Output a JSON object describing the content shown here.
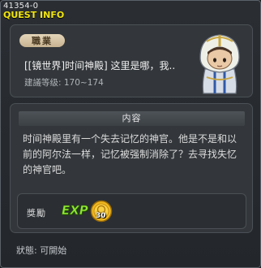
{
  "window": {
    "id_label": "41354-0",
    "title": "QUEST INFO"
  },
  "quest": {
    "job_badge": "職業",
    "name": "[[镜世界]时间神殿] 这里是哪，我..",
    "level_requirement": "建議等级: 170~174"
  },
  "content": {
    "header": "内容",
    "description": "时间神殿里有一个失去记忆的神官。他是不是和以前的阿尔法一样，记忆被强制消除了？去寻找失忆的神官吧。"
  },
  "reward": {
    "label": "獎勵",
    "exp_text": "EXP",
    "coin_quantity": "30"
  },
  "status": {
    "text": "狀態: 可開始"
  },
  "icons": {
    "npc": "hooded-priest-npc-icon",
    "exp": "exp-icon",
    "coin": "gold-coin-icon"
  }
}
